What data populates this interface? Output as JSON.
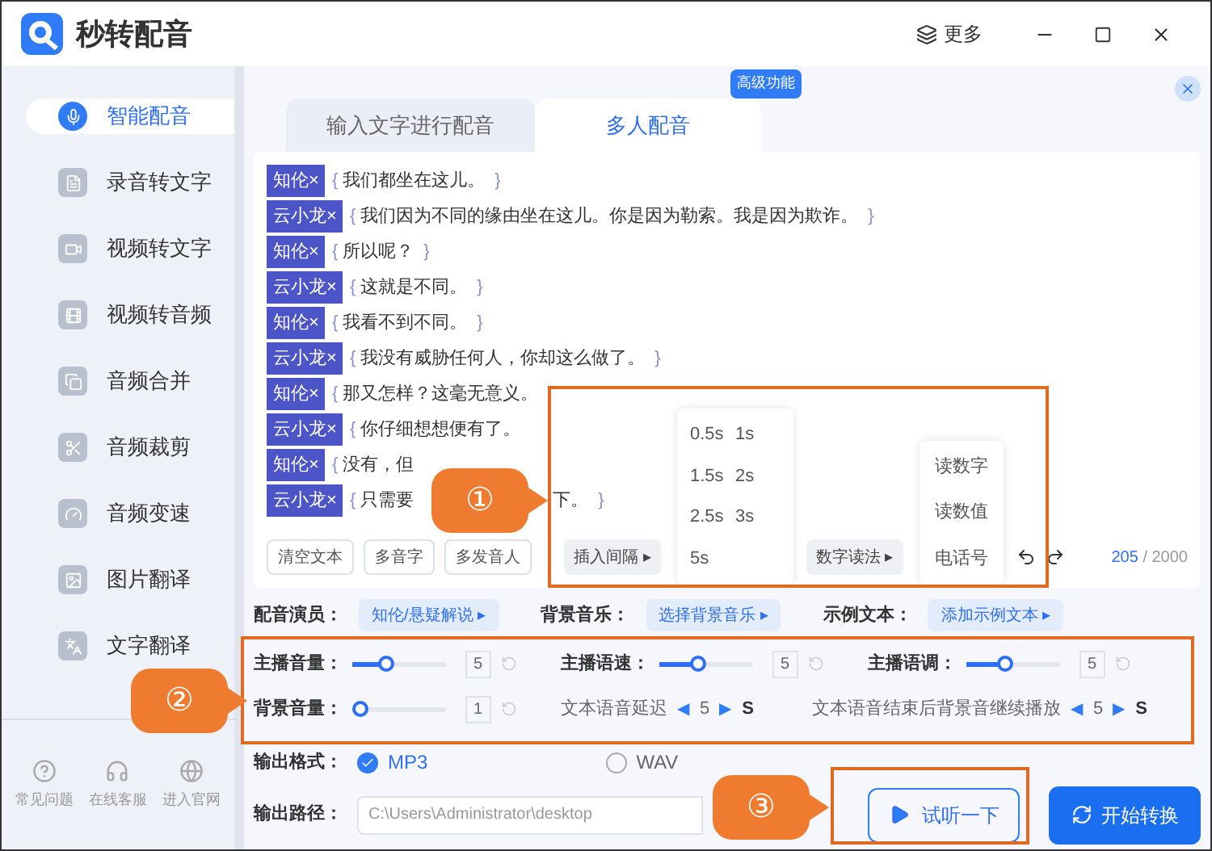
{
  "app": {
    "title": "秒转配音",
    "more": "更多"
  },
  "sidebar": {
    "items": [
      {
        "label": "智能配音",
        "selected": true
      },
      {
        "label": "录音转文字",
        "selected": false
      },
      {
        "label": "视频转文字",
        "selected": false
      },
      {
        "label": "视频转音频",
        "selected": false
      },
      {
        "label": "音频合并",
        "selected": false
      },
      {
        "label": "音频裁剪",
        "selected": false
      },
      {
        "label": "音频变速",
        "selected": false
      },
      {
        "label": "图片翻译",
        "selected": false
      },
      {
        "label": "文字翻译",
        "selected": false
      }
    ],
    "footer": [
      "常见问题",
      "在线客服",
      "进入官网"
    ]
  },
  "tabs": [
    {
      "label": "输入文字进行配音",
      "selected": false
    },
    {
      "label": "多人配音",
      "selected": true,
      "badge": "高级功能"
    }
  ],
  "dialogue": [
    {
      "speaker": "知伦×",
      "open": "{",
      "text": "我们都坐在这儿。",
      "close": "}"
    },
    {
      "speaker": "云小龙×",
      "open": "{",
      "text": "我们因为不同的缘由坐在这儿。你是因为勒索。我是因为欺诈。",
      "close": "}"
    },
    {
      "speaker": "知伦×",
      "open": "{",
      "text": "所以呢？",
      "close": "}"
    },
    {
      "speaker": "云小龙×",
      "open": "{",
      "text": "这就是不同。",
      "close": "}"
    },
    {
      "speaker": "知伦×",
      "open": "{",
      "text": "我看不到不同。",
      "close": "}"
    },
    {
      "speaker": "云小龙×",
      "open": "{",
      "text": "我没有威胁任何人，你却这么做了。",
      "close": "}"
    },
    {
      "speaker": "知伦×",
      "open": "{",
      "text": "那又怎样？这毫无意义。"
    },
    {
      "speaker": "云小龙×",
      "open": "{",
      "text": "你仔细想想便有了。"
    },
    {
      "speaker": "知伦×",
      "open": "{",
      "text": "没有，但"
    },
    {
      "speaker": "云小龙×",
      "open": "{",
      "text": "只需要",
      "tail": "下。",
      "close": "}"
    }
  ],
  "toolbar": {
    "buttons": [
      "清空文本",
      "多音字",
      "多发音人"
    ],
    "interval": {
      "label": "插入间隔",
      "arrow": "▸",
      "options": [
        "0.5s",
        "1s",
        "1.5s",
        "2s",
        "2.5s",
        "3s",
        "5s"
      ]
    },
    "number_reading": {
      "label": "数字读法",
      "arrow": "▸",
      "options": [
        "读数字",
        "读数值",
        "电话号"
      ]
    },
    "count": "205",
    "limit": "/ 2000"
  },
  "pickers": [
    {
      "label": "配音演员：",
      "value": "知伦/悬疑解说 ▸"
    },
    {
      "label": "背景音乐：",
      "value": "选择背景音乐 ▸"
    },
    {
      "label": "示例文本：",
      "value": "添加示例文本 ▸"
    }
  ],
  "sliders": [
    {
      "label": "主播音量：",
      "level": 0.33,
      "value": "5"
    },
    {
      "label": "主播语速：",
      "level": 0.4,
      "value": "5"
    },
    {
      "label": "主播语调：",
      "level": 0.4,
      "value": "5"
    },
    {
      "label": "背景音量：",
      "level": 0,
      "value": "1"
    }
  ],
  "steppers": [
    {
      "label": "文本语音延迟",
      "prev": "◀",
      "value": "5",
      "next": "▶",
      "unit": "S"
    },
    {
      "label": "文本语音结束后背景音继续播放",
      "prev": "◀",
      "value": "5",
      "next": "▶",
      "unit": "S"
    }
  ],
  "output_format": {
    "label": "输出格式：",
    "options": [
      {
        "label": "MP3",
        "selected": true
      },
      {
        "label": "WAV",
        "selected": false
      }
    ]
  },
  "output_path": {
    "label": "输出路径：",
    "value": "C:\\Users\\Administrator\\desktop"
  },
  "actions": [
    {
      "label": "试听一下",
      "kind": "preview"
    },
    {
      "label": "开始转换",
      "kind": "convert"
    }
  ],
  "callouts": [
    "①",
    "②",
    "③"
  ]
}
